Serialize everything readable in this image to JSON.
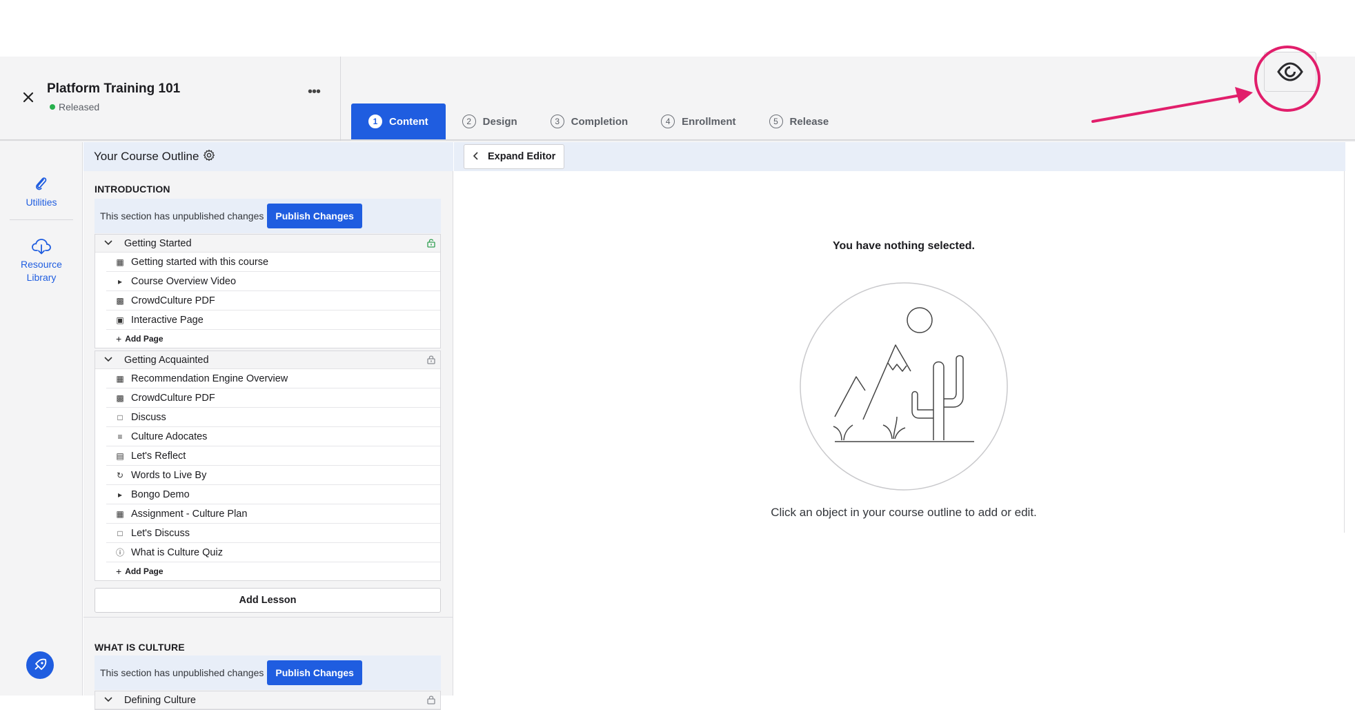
{
  "header": {
    "title": "Platform Training 101",
    "status": "Released",
    "more_label": "•••"
  },
  "tabs": [
    {
      "num": "1",
      "label": "Content"
    },
    {
      "num": "2",
      "label": "Design"
    },
    {
      "num": "3",
      "label": "Completion"
    },
    {
      "num": "4",
      "label": "Enrollment"
    },
    {
      "num": "5",
      "label": "Release"
    }
  ],
  "rail": {
    "utilities": "Utilities",
    "resource_line1": "Resource",
    "resource_line2": "Library"
  },
  "outline": {
    "header": "Your Course Outline",
    "sections": [
      {
        "title": "INTRODUCTION",
        "unpublished_text": "This section has unpublished changes",
        "publish_label": "Publish Changes",
        "lessons": [
          {
            "title": "Getting Started",
            "lock_color": "#2e9e4f",
            "pages": [
              {
                "icon": "document-icon",
                "title": "Getting started with this course"
              },
              {
                "icon": "video-icon",
                "title": "Course Overview Video"
              },
              {
                "icon": "pdf-icon",
                "title": "CrowdCulture PDF"
              },
              {
                "icon": "interactive-icon",
                "title": "Interactive Page"
              }
            ],
            "add_page": "Add Page"
          },
          {
            "title": "Getting Acquainted",
            "lock_color": "#8a8d93",
            "pages": [
              {
                "icon": "document-icon",
                "title": "Recommendation Engine Overview"
              },
              {
                "icon": "pdf-icon",
                "title": "CrowdCulture PDF"
              },
              {
                "icon": "discussion-icon",
                "title": "Discuss"
              },
              {
                "icon": "list-icon",
                "title": "Culture Adocates"
              },
              {
                "icon": "reflection-icon",
                "title": "Let's Reflect"
              },
              {
                "icon": "repeat-icon",
                "title": "Words to Live By"
              },
              {
                "icon": "video-icon",
                "title": "Bongo Demo"
              },
              {
                "icon": "assignment-icon",
                "title": "Assignment - Culture Plan"
              },
              {
                "icon": "discussion-icon",
                "title": "Let's Discuss"
              },
              {
                "icon": "quiz-icon",
                "title": "What is Culture Quiz"
              }
            ],
            "add_page": "Add Page"
          }
        ],
        "add_lesson": "Add Lesson"
      },
      {
        "title": "WHAT IS CULTURE",
        "unpublished_text": "This section has unpublished changes",
        "publish_label": "Publish Changes",
        "lessons": [
          {
            "title": "Defining Culture",
            "lock_color": "#8a8d93"
          }
        ]
      }
    ]
  },
  "main": {
    "expand_label": "Expand Editor",
    "nothing_selected": "You have nothing selected.",
    "hint": "Click an object in your course outline to add or edit."
  },
  "colors": {
    "accent": "#1f5de0",
    "annotation": "#e11e6b",
    "released": "#27b04d"
  }
}
